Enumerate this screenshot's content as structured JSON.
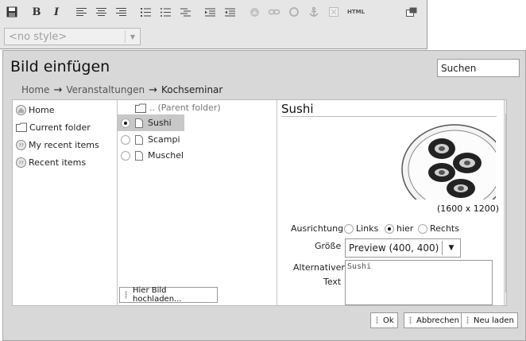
{
  "toolbar": {
    "buttons": [
      {
        "name": "save-icon",
        "label": ""
      },
      {
        "name": "bold-icon",
        "label": "B"
      },
      {
        "name": "italic-icon",
        "label": "I"
      },
      {
        "name": "align-left-icon",
        "label": ""
      },
      {
        "name": "align-center-icon",
        "label": ""
      },
      {
        "name": "align-right-icon",
        "label": ""
      },
      {
        "name": "ordered-list-icon",
        "label": ""
      },
      {
        "name": "unordered-list-icon",
        "label": ""
      },
      {
        "name": "definition-list-icon",
        "label": ""
      },
      {
        "name": "indent-icon",
        "label": ""
      },
      {
        "name": "outdent-icon",
        "label": ""
      },
      {
        "name": "insert-image-icon",
        "label": ""
      },
      {
        "name": "link-icon",
        "label": ""
      },
      {
        "name": "unlink-icon",
        "label": ""
      },
      {
        "name": "anchor-icon",
        "label": ""
      },
      {
        "name": "table-icon",
        "label": ""
      },
      {
        "name": "html-icon",
        "label": "HTML"
      }
    ],
    "style_select": {
      "value": "<no style>"
    }
  },
  "dialog": {
    "title": "Bild einfügen",
    "search": {
      "value": "Suchen"
    },
    "breadcrumb": [
      "Home",
      "Veranstaltungen",
      "Kochseminar"
    ],
    "nav_items": [
      "Home",
      "Current folder",
      "My recent items",
      "Recent items"
    ],
    "parent_folder": ".. (Parent folder)",
    "files": [
      {
        "label": "Sushi",
        "selected": true
      },
      {
        "label": "Scampi",
        "selected": false
      },
      {
        "label": "Muschel",
        "selected": false
      }
    ],
    "upload_button": "Hier Bild hochladen...",
    "preview": {
      "title": "Sushi",
      "dimensions": "(1600 x 1200)",
      "alignment_label": "Ausrichtung",
      "alignment_options": [
        "Links",
        "hier",
        "Rechts"
      ],
      "alignment_selected": "hier",
      "size_label": "Größe",
      "size_value": "Preview (400, 400)",
      "alt_label_1": "Alternativer",
      "alt_label_2": "Text",
      "alt_value": "Sushi"
    },
    "buttons": {
      "ok": "Ok",
      "cancel": "Abbrechen",
      "reload": "Neu laden"
    }
  },
  "colors": {
    "dialog_bg": "#d8d8d8",
    "toolbar_bg": "#e6e6e6",
    "selection": "#c8c8c8"
  }
}
